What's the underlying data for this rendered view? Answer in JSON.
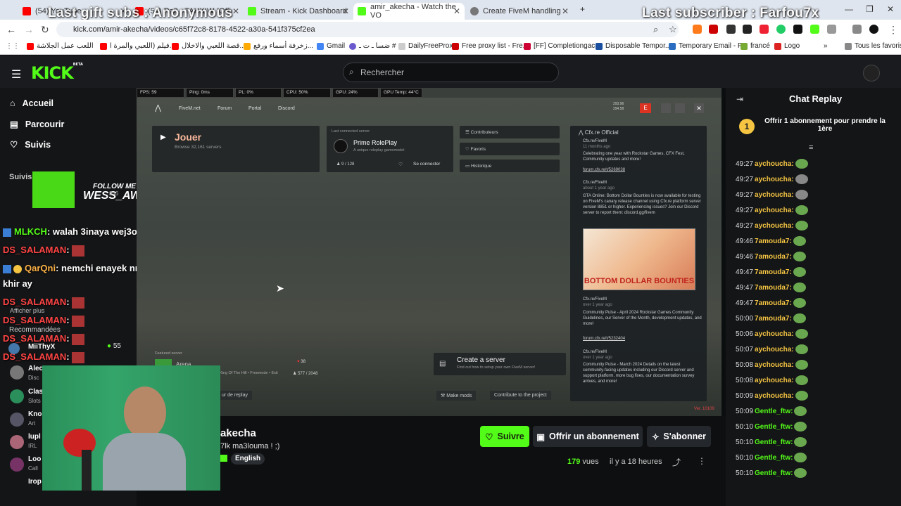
{
  "browser": {
    "tabs": [
      {
        "title": "(54) YouTube",
        "color": "#ff0000"
      },
      {
        "title": "(54) Ra3 - TAHKIW (Official Au",
        "color": "#ff0000"
      },
      {
        "title": "Stream - Kick Dashboard",
        "color": "#53fc18"
      },
      {
        "title": "amir_akecha - Watch the VO",
        "color": "#53fc18"
      },
      {
        "title": "Create FiveM handling",
        "color": "#777777"
      }
    ],
    "url": "kick.com/amir-akecha/videos/c65f72c8-8178-4522-a30a-541f375cf2ea",
    "bookmarks": [
      "اللعب عمل الجلاشة",
      "فيلم (اللعبي والمرة ا...",
      "قصة اللعبي والاخلال...",
      "زخرفة أسماء ورفع...",
      "Gmail",
      "ضسا ـ ت ـ #",
      "DailyFreeProxy",
      "Free proxy list - Fre...",
      "[FF] Completiongac...",
      "Disposable Tempor...",
      "Temporary Email - F...",
      "francé",
      "Logo"
    ],
    "all_bookmarks": "Tous les favoris"
  },
  "overlay": {
    "gift": "Last gift subs : Anonymous",
    "subscriber": "Last subscriber : Farfou7x"
  },
  "kick": {
    "logo": "KICK",
    "beta": "BETA",
    "search_placeholder": "Rechercher",
    "nav": [
      "Accueil",
      "Parcourir",
      "Suivis"
    ],
    "suivis_header": "Suivis",
    "more": "Afficher plus",
    "recommended": "Recommandées",
    "viewer_count": "55",
    "follow_me": "FOLLOW ME",
    "wess": "WESS_AWM",
    "count_846": "846"
  },
  "left_chat": [
    {
      "user": "MLKCH",
      "text": ": walah 3inaya wej3ouni b chat",
      "color": "#53fc18"
    },
    {
      "user": "DS_SALAMAN",
      "text": ":",
      "color": "#ff4444"
    },
    {
      "user": "QarQni",
      "text": ": nemchi enayek nrigel awra",
      "color": "#ffb347"
    },
    {
      "user": "",
      "text": "khir ay",
      "color": "#ffffff"
    },
    {
      "user": "DS_SALAMAN",
      "text": ":",
      "color": "#ff4444"
    },
    {
      "user": "DS_SALAMAN",
      "text": ":",
      "color": "#ff4444"
    },
    {
      "user": "DS_SALAMAN",
      "text": ":",
      "color": "#ff4444"
    },
    {
      "user": "DS_SALAMAN",
      "text": ":",
      "color": "#ff4444"
    }
  ],
  "side_users": [
    {
      "name": "MiiThyX"
    },
    {
      "name": "Alec",
      "sub": "Disc"
    },
    {
      "name": "Clas",
      "sub": "Slots"
    },
    {
      "name": "Kno",
      "sub": "Art"
    },
    {
      "name": "lupl",
      "sub": "IRL"
    },
    {
      "name": "Loo",
      "sub": "Call"
    },
    {
      "name": "Irop"
    }
  ],
  "game": {
    "stats": [
      "FPS: 59",
      "Ping: 0ms",
      "PL: 0%",
      "CPU: 50%",
      "GPU: 24%",
      "GPU Temp: 44°C"
    ],
    "menu": [
      "FiveM.net",
      "Forum",
      "Portal",
      "Discord"
    ],
    "play": "Jouer",
    "browse": "Browse 32,161 servers",
    "last_connected": "Last connected server",
    "server": "Prime RolePlay",
    "server_desc": "A unique roleplay gamemodel",
    "players": "9 / 128",
    "connect": "Se connecter",
    "side_buttons": [
      "Contributeurs",
      "Favoris",
      "Historique"
    ],
    "counts": [
      "293.96",
      "294.58"
    ],
    "featured": "Featured server",
    "arena": "Arena",
    "arena_desc": "King Of The Hill • Freemode • Exti",
    "arena_players": "577 / 2048",
    "arena_likes": "38",
    "create_server": "Create a server",
    "create_desc": "Find out how to setup your own FiveM server!",
    "make_mods": "Make mods",
    "contribute": "Contribute to the project",
    "replay_frag": "ur de replay",
    "version": "Ver. 10109",
    "feed_title": "Cfx.re Official",
    "feed": [
      {
        "author": "Cfx.re/FiveM",
        "time": "11 months ago",
        "text": "Celebrating one year with Rockstar Games, CFX Fest, Community updates and more!",
        "link": "forum.cfx.re/t/5269038"
      },
      {
        "author": "Cfx.re/FiveM",
        "time": "about 1 year ago",
        "text": "GTA Online: Bottom Dollar Bounties is now available for testing on FiveM's canary release channel using Cfx.re platform server version 8851 or higher. Experiencing issues? Join our Discord server to report them: discord.gg/fivem",
        "link": ""
      },
      {
        "author": "Cfx.re/FiveM",
        "time": "over 1 year ago",
        "text": "Community Pulse - April 2024 Rockstar Games Community Guidelines, our Server of the Month, development updates, and more!",
        "link": "forum.cfx.re/t/5232404"
      },
      {
        "author": "Cfx.re/FiveM",
        "time": "over 1 year ago",
        "text": "Community Pulse - March 2024 Details on the latest community-facing updates including our Discord server and support platform, more bug fixes, our documentation survey arrives, and more!",
        "link": ""
      }
    ],
    "poster_title": "BOTTOM DOLLAR BOUNTIES"
  },
  "video_info": {
    "channel": "akecha",
    "title": "7lk ma3louma ! ;)",
    "tag": "English",
    "views_num": "179",
    "views_label": "vues",
    "time": "il y a 18 heures",
    "follow": "Suivre",
    "gift": "Offrir un abonnement",
    "subscribe": "S'abonner"
  },
  "chat": {
    "title": "Chat Replay",
    "pinned": "Offrir 1 abonnement pour prendre la 1ère",
    "pinned_num": "1",
    "messages": [
      {
        "time": "49:27",
        "user": "aychoucha:",
        "color": "#f5c542",
        "emote": "#6aa84f"
      },
      {
        "time": "49:27",
        "user": "aychoucha:",
        "color": "#f5c542",
        "emote": "#888888"
      },
      {
        "time": "49:27",
        "user": "aychoucha:",
        "color": "#f5c542",
        "emote": "#888888"
      },
      {
        "time": "49:27",
        "user": "aychoucha:",
        "color": "#f5c542",
        "emote": "#6aa84f"
      },
      {
        "time": "49:27",
        "user": "aychoucha:",
        "color": "#f5c542",
        "emote": "#6aa84f"
      },
      {
        "time": "49:46",
        "user": "7amouda7:",
        "color": "#f5c542",
        "emote": "#6aa84f"
      },
      {
        "time": "49:46",
        "user": "7amouda7:",
        "color": "#f5c542",
        "emote": "#6aa84f"
      },
      {
        "time": "49:47",
        "user": "7amouda7:",
        "color": "#f5c542",
        "emote": "#6aa84f"
      },
      {
        "time": "49:47",
        "user": "7amouda7:",
        "color": "#f5c542",
        "emote": "#6aa84f"
      },
      {
        "time": "49:47",
        "user": "7amouda7:",
        "color": "#f5c542",
        "emote": "#6aa84f"
      },
      {
        "time": "50:00",
        "user": "7amouda7:",
        "color": "#f5c542",
        "emote": "#6aa84f"
      },
      {
        "time": "50:06",
        "user": "aychoucha:",
        "color": "#f5c542",
        "emote": "#6aa84f"
      },
      {
        "time": "50:07",
        "user": "aychoucha:",
        "color": "#f5c542",
        "emote": "#6aa84f"
      },
      {
        "time": "50:08",
        "user": "aychoucha:",
        "color": "#f5c542",
        "emote": "#6aa84f"
      },
      {
        "time": "50:08",
        "user": "aychoucha:",
        "color": "#f5c542",
        "emote": "#6aa84f"
      },
      {
        "time": "50:09",
        "user": "aychoucha:",
        "color": "#f5c542",
        "emote": "#6aa84f"
      },
      {
        "time": "50:09",
        "user": "Gentle_ftw:",
        "color": "#53fc18",
        "emote": "#6aa84f"
      },
      {
        "time": "50:10",
        "user": "Gentle_ftw:",
        "color": "#53fc18",
        "emote": "#6aa84f"
      },
      {
        "time": "50:10",
        "user": "Gentle_ftw:",
        "color": "#53fc18",
        "emote": "#6aa84f"
      },
      {
        "time": "50:10",
        "user": "Gentle_ftw:",
        "color": "#53fc18",
        "emote": "#6aa84f"
      },
      {
        "time": "50:10",
        "user": "Gentle_ftw:",
        "color": "#53fc18",
        "emote": "#6aa84f"
      }
    ]
  }
}
